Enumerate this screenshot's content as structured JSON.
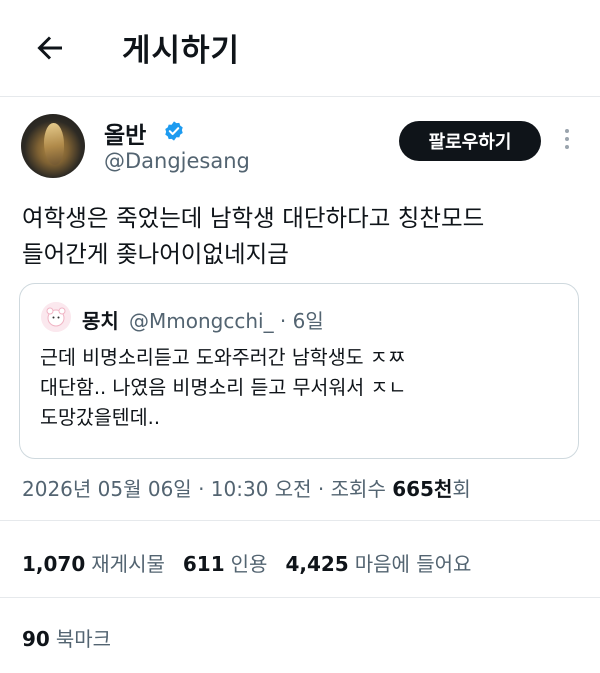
{
  "header": {
    "title": "게시하기"
  },
  "author": {
    "name": "올반",
    "handle": "@Dangjesang",
    "follow_label": "팔로우하기"
  },
  "tweet": {
    "text_line1": "여학생은 죽었는데 남학생 대단하다고 칭찬모드",
    "text_line2": "들어간게 좆나어이없네지금"
  },
  "quote": {
    "name": "몽치",
    "handle": "@Mmongcchi_ · 6일",
    "line1": "근데 비명소리듣고 도와주러간 남학생도 ㅈㅉ",
    "line2": "대단함.. 나였음 비명소리 듣고 무서워서 ㅈㄴ",
    "line3": "도망갔을텐데.."
  },
  "meta": {
    "datetime": "2026년 05월 06일 · 10:30 오전 · 조회수 ",
    "views": "665천",
    "views_suffix": "회"
  },
  "stats": {
    "retweets": "1,070",
    "retweets_label": "재게시물",
    "quotes": "611",
    "quotes_label": "인용",
    "likes": "4,425",
    "likes_label": "마음에 들어요"
  },
  "bookmarks": {
    "count": "90",
    "label": "북마크"
  },
  "colors": {
    "text": "#0f1419",
    "secondary": "#536471",
    "verified": "#1d9bf0",
    "border": "#cfd9de"
  },
  "icons": {
    "back": "arrow-left-icon",
    "verified": "verified-badge-icon",
    "more": "more-vertical-icon"
  }
}
